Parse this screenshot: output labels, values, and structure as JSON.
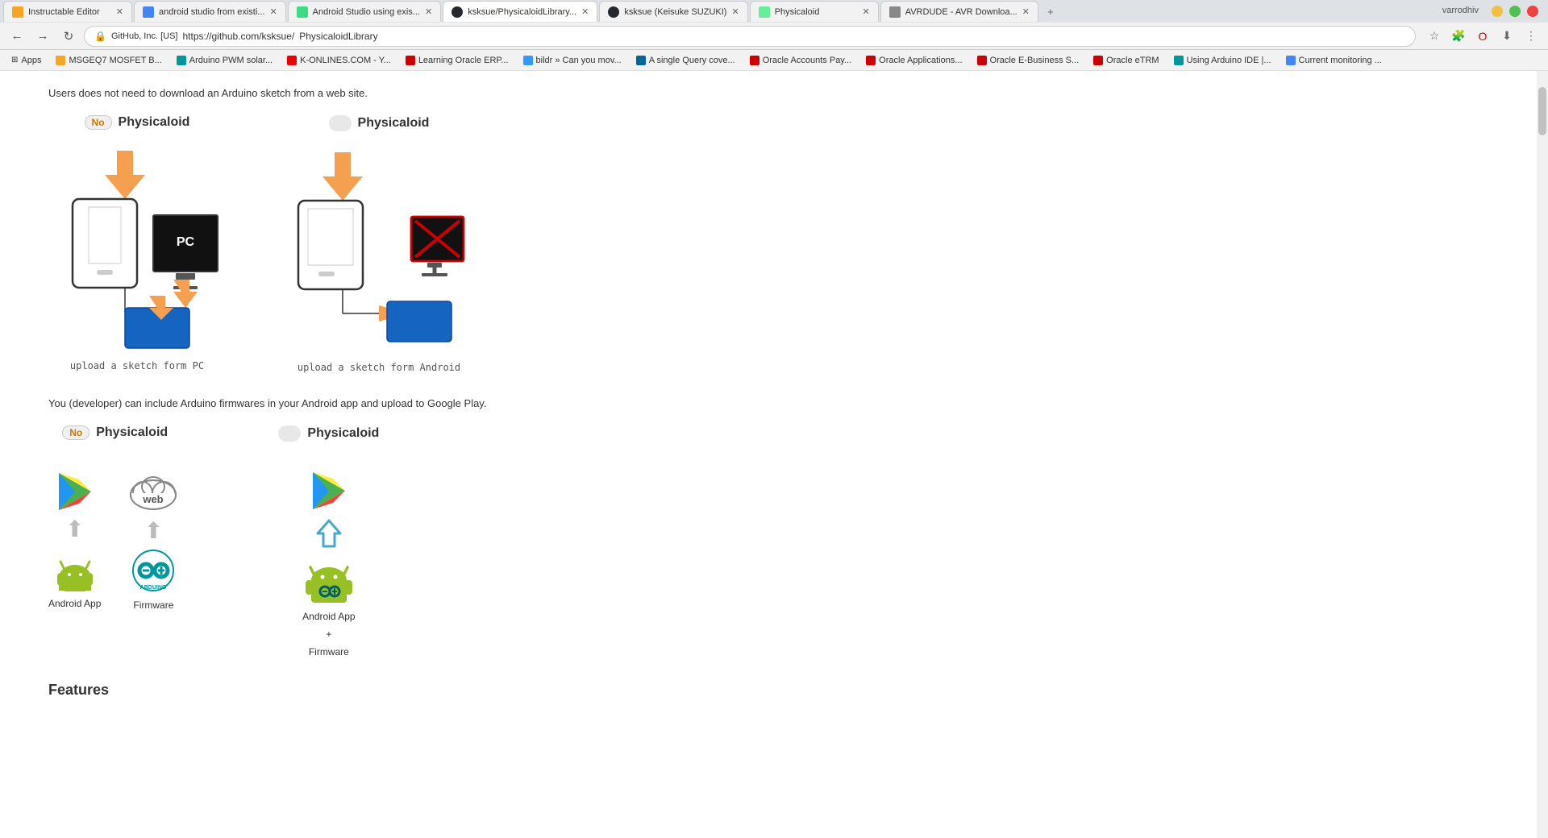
{
  "browser": {
    "tabs": [
      {
        "id": "tab1",
        "label": "Instructable Editor",
        "favicon": "instructable",
        "active": false,
        "closeable": true
      },
      {
        "id": "tab2",
        "label": "android studio from existi...",
        "favicon": "google",
        "active": false,
        "closeable": true
      },
      {
        "id": "tab3",
        "label": "Android Studio using exis...",
        "favicon": "android-studio",
        "active": false,
        "closeable": true
      },
      {
        "id": "tab4",
        "label": "ksksue/PhysicaloidLibrary...",
        "favicon": "github",
        "active": true,
        "closeable": true
      },
      {
        "id": "tab5",
        "label": "ksksue (Keisuke SUZUKI)",
        "favicon": "github",
        "active": false,
        "closeable": true
      },
      {
        "id": "tab6",
        "label": "Physicaloid",
        "favicon": "physicaloid",
        "active": false,
        "closeable": true
      },
      {
        "id": "tab7",
        "label": "AVRDUDE - AVR Downloa...",
        "favicon": "avrdude",
        "active": false,
        "closeable": true
      }
    ],
    "window_controls": {
      "minimize": "—",
      "restore": "⧠",
      "close": "✕"
    },
    "address": {
      "secure_text": "GitHub, Inc. [US]",
      "url_prefix": "https://github.com/ksksue/",
      "url_suffix": "PhysicaloidLibrary"
    },
    "bookmarks": [
      {
        "label": "Apps",
        "icon": "apps"
      },
      {
        "label": "MSGEQ7 MOSFET B...",
        "icon": "bookmark"
      },
      {
        "label": "Arduino PWM solar...",
        "icon": "bookmark"
      },
      {
        "label": "K-ONLINES.COM - Y...",
        "icon": "bookmark"
      },
      {
        "label": "Learning Oracle ERP...",
        "icon": "bookmark"
      },
      {
        "label": "bildr » Can you mov...",
        "icon": "bookmark"
      },
      {
        "label": "A single Query cove...",
        "icon": "bookmark"
      },
      {
        "label": "Oracle Accounts Pay...",
        "icon": "bookmark"
      },
      {
        "label": "Oracle Applications...",
        "icon": "bookmark"
      },
      {
        "label": "Oracle E-Business S...",
        "icon": "bookmark"
      },
      {
        "label": "Oracle eTRM",
        "icon": "bookmark"
      },
      {
        "label": "Using Arduino IDE |...",
        "icon": "bookmark"
      },
      {
        "label": "Current monitoring ...",
        "icon": "bookmark"
      }
    ]
  },
  "page": {
    "intro_text": "Users does not need to download an Arduino sketch from a web site.",
    "second_text": "You (developer) can include Arduino firmwares in your Android app and upload to Google Play.",
    "diagram1": {
      "header_no": "No",
      "header_title": "Physicaloid",
      "caption": "upload a sketch form PC"
    },
    "diagram2": {
      "header_title": "Physicaloid",
      "caption": "upload a sketch form Android"
    },
    "diagram3": {
      "header_no": "No",
      "header_title": "Physicaloid",
      "label1": "Android App",
      "label2": "Firmware"
    },
    "diagram4": {
      "header_title": "Physicaloid",
      "label1": "Android App",
      "label2": "+",
      "label3": "Firmware"
    },
    "features_heading": "Features"
  }
}
